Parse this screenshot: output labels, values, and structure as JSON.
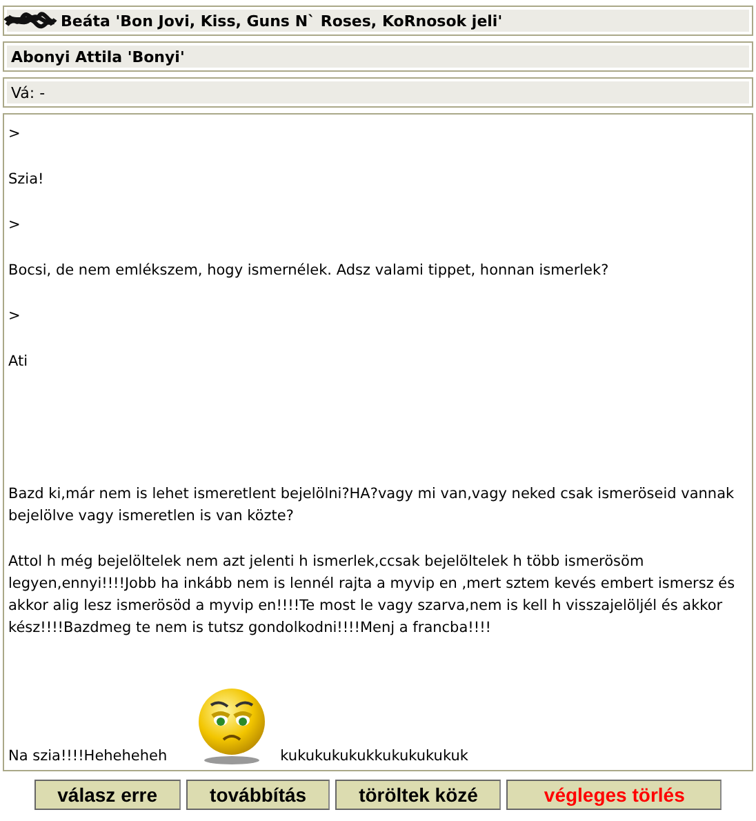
{
  "header_fields": [
    {
      "kind": "redacted",
      "text": "Beáta 'Bon Jovi, Kiss, Guns N` Roses, KoRnosok jeli'"
    },
    {
      "kind": "bold",
      "text": "Abonyi Attila 'Bonyi'"
    },
    {
      "kind": "plain",
      "text": "Vá: -"
    }
  ],
  "message": {
    "paragraphs": [
      ">",
      "Szia!",
      ">",
      "Bocsi, de nem emlékszem, hogy ismernélek. Adsz valami tippet, honnan ismerlek?",
      ">",
      "Ati",
      "Bazd ki,már nem is lehet ismeretlent bejelölni?HA?vagy mi van,vagy neked csak ismeröseid vannak bejelölve vagy ismeretlen is van közte?",
      "Attol h még bejelöltelek nem azt jelenti h ismerlek,ccsak bejelöltelek h több ismerösöm legyen,ennyi!!!!Jobb ha inkább nem is lennél rajta a myvip en ,mert sztem kevés embert ismersz és akkor alig lesz ismerösöd a myvip en!!!!Te most le vagy szarva,nem is kell h visszajelöljél és akkor kész!!!!Bazdmeg te nem is tutsz gondolkodni!!!!Menj a francba!!!!"
    ],
    "last_line": {
      "before": "Na szia!!!!Heheheheh",
      "after": "kukukukukukkukukukukuk"
    }
  },
  "buttons": [
    {
      "label": "válasz erre",
      "kind": "normal"
    },
    {
      "label": "továbbítás",
      "kind": "normal"
    },
    {
      "label": "töröltek közé",
      "kind": "normal"
    },
    {
      "label": "végleges törlés",
      "kind": "danger"
    }
  ]
}
